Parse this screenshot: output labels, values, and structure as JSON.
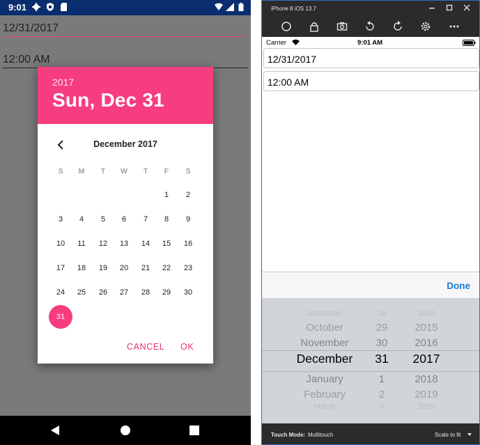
{
  "android": {
    "status_time": "9:01",
    "date_field": "12/31/2017",
    "time_field": "12:00 AM",
    "dialog": {
      "header_year": "2017",
      "header_date": "Sun, Dec 31",
      "month_label": "December 2017",
      "weekdays": [
        "S",
        "M",
        "T",
        "W",
        "T",
        "F",
        "S"
      ],
      "days": [
        "1",
        "2",
        "3",
        "4",
        "5",
        "6",
        "7",
        "8",
        "9",
        "10",
        "11",
        "12",
        "13",
        "14",
        "15",
        "16",
        "17",
        "18",
        "19",
        "20",
        "21",
        "22",
        "23",
        "24",
        "25",
        "26",
        "27",
        "28",
        "29",
        "30",
        "31"
      ],
      "first_weekday": 5,
      "selected_day": "31",
      "cancel_label": "CANCEL",
      "ok_label": "OK"
    },
    "accent_color": "#f63d7f",
    "status_bar_color": "#0a2d6e"
  },
  "ios": {
    "window_title": "iPhone 8 iOS 13.7",
    "carrier": "Carrier",
    "status_time": "9:01 AM",
    "date_field": "12/31/2017",
    "time_field": "12:00 AM",
    "done_label": "Done",
    "picker": {
      "months": [
        "September",
        "October",
        "November",
        "December",
        "January",
        "February",
        "March"
      ],
      "days": [
        "28",
        "29",
        "30",
        "31",
        "1",
        "2",
        "3"
      ],
      "years": [
        "2014",
        "2015",
        "2016",
        "2017",
        "2018",
        "2019",
        "2020"
      ],
      "selected_index": 3
    },
    "touch_mode_label": "Touch Mode:",
    "touch_mode_value": "Multitouch",
    "scale_label": "Scale to fit",
    "accent_color": "#1a7ad9"
  }
}
